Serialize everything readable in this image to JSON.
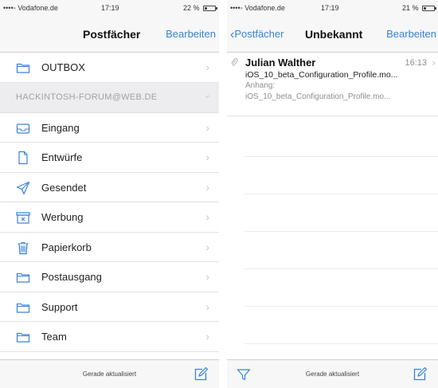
{
  "colors": {
    "accent": "#3a83d9",
    "separator": "#e2e2e4",
    "section_bg": "#ededf0"
  },
  "left": {
    "statusbar": {
      "carrier": "••••◦ Vodafone.de",
      "time": "17:19",
      "battery": "22 %"
    },
    "nav": {
      "title": "Postfächer",
      "edit": "Bearbeiten"
    },
    "outbox": {
      "label": "OUTBOX",
      "icon": "folder-icon"
    },
    "account": {
      "label": "HACKINTOSH-FORUM@WEB.DE"
    },
    "folders": [
      {
        "label": "Eingang",
        "icon": "inbox-icon"
      },
      {
        "label": "Entwürfe",
        "icon": "document-icon"
      },
      {
        "label": "Gesendet",
        "icon": "paperplane-icon"
      },
      {
        "label": "Werbung",
        "icon": "junk-icon"
      },
      {
        "label": "Papierkorb",
        "icon": "trash-icon"
      },
      {
        "label": "Postausgang",
        "icon": "folder-icon"
      },
      {
        "label": "Support",
        "icon": "folder-icon"
      },
      {
        "label": "Team",
        "icon": "folder-icon"
      }
    ],
    "toolbar": {
      "status": "Gerade aktualisiert",
      "compose_icon": "compose-icon"
    }
  },
  "right": {
    "statusbar": {
      "carrier": "••••◦ Vodafone.de",
      "time": "17:19",
      "battery": "21 %"
    },
    "nav": {
      "back": "Postfächer",
      "title": "Unbekannt",
      "edit": "Bearbeiten"
    },
    "message": {
      "sender": "Julian Walther",
      "time": "16:13",
      "subject": "iOS_10_beta_Configuration_Profile.mo...",
      "preview_line1": "Anhang:",
      "preview_line2": "iOS_10_beta_Configuration_Profile.mo..."
    },
    "toolbar": {
      "status": "Gerade aktualisiert",
      "filter_icon": "filter-icon",
      "compose_icon": "compose-icon"
    }
  }
}
